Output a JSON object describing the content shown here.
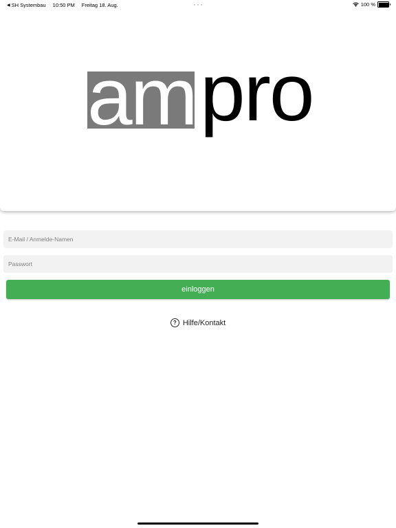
{
  "status_bar": {
    "back_app": "SH Systembau",
    "time": "10:50 PM",
    "date": "Freitag 18. Aug.",
    "battery": "100 %",
    "battery_level": 1.0,
    "icons": [
      "back-arrow-icon",
      "wifi-icon",
      "battery-icon"
    ]
  },
  "logo": {
    "part1": "am",
    "part2": "pro",
    "part1_color": "#ffffff",
    "part1_bg": "#7a7a7a",
    "part2_color": "#000000"
  },
  "form": {
    "email_placeholder": "E-Mail / Anmelde-Namen",
    "email_value": "",
    "password_placeholder": "Passwort",
    "password_value": "",
    "login_label": "einloggen",
    "login_color": "#43ae53"
  },
  "help": {
    "label": "Hilfe/Kontakt",
    "icon": "question-circle-icon"
  }
}
